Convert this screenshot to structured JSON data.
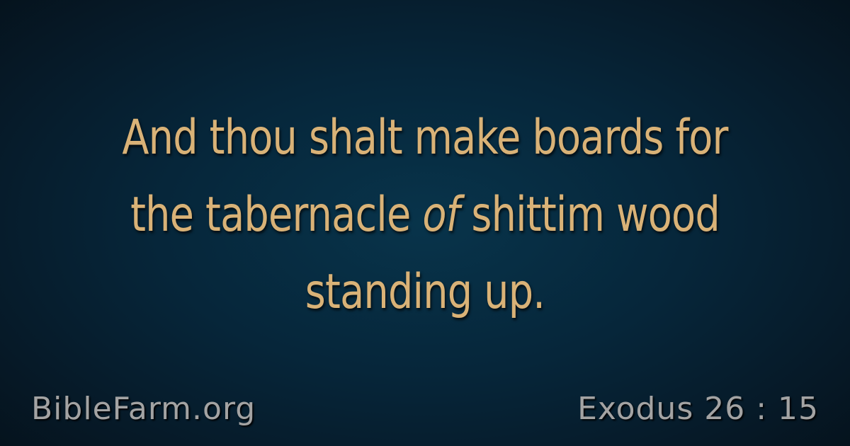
{
  "verse": {
    "line1": "And thou shalt make boards for",
    "line2_before": "the tabernacle ",
    "line2_italic": "of",
    "line2_after": " shittim wood",
    "line3": "standing up."
  },
  "footer": {
    "site": "BibleFarm.org",
    "reference": "Exodus 26 : 15"
  },
  "colors": {
    "verse_text": "#d9b277",
    "footer_text": "#a3a3a3",
    "background_center": "#08344b",
    "background_edge": "#05121c"
  }
}
